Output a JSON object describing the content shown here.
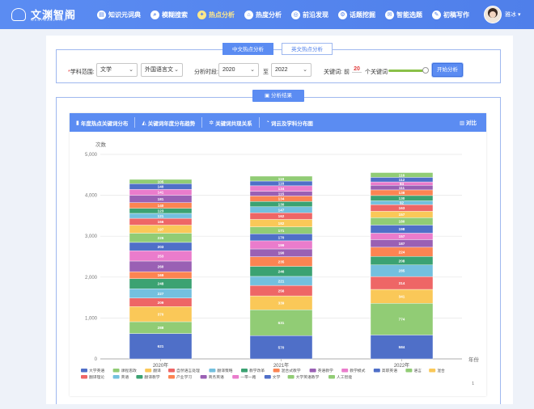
{
  "brand": {
    "name": "文渊智阁",
    "sub": "WENYUANZHIGE"
  },
  "nav": [
    {
      "label": "知识元词典",
      "icon": "book-icon"
    },
    {
      "label": "模糊搜索",
      "icon": "search-icon"
    },
    {
      "label": "热点分析",
      "icon": "bulb-icon",
      "active": true
    },
    {
      "label": "热度分析",
      "icon": "home-icon"
    },
    {
      "label": "前沿发现",
      "icon": "compass-icon"
    },
    {
      "label": "话题挖掘",
      "icon": "gear-icon"
    },
    {
      "label": "智能选题",
      "icon": "chat-icon"
    },
    {
      "label": "初稿写作",
      "icon": "pen-icon"
    }
  ],
  "user": {
    "name": "雅冰 ▾"
  },
  "lang_tabs": {
    "cn": "中文热点分析",
    "en": "英文热点分析"
  },
  "filters": {
    "subject_label": "学科范围:",
    "subject_req": "*",
    "subject_value": "文学",
    "subject_sub": "外国语言文",
    "period_label": "分析时段:",
    "year_from": "2020",
    "to_label": "至",
    "year_to": "2022",
    "kw_label": "关键词:",
    "kw_prefix": "前",
    "kw_count": "20",
    "kw_suffix": "个关键词",
    "start_btn": "开始分析"
  },
  "result_label": "分析结果",
  "chart_tabs": [
    {
      "label": "年度热点关键词分布",
      "icon": "bar-icon"
    },
    {
      "label": "关键词年度分布趋势",
      "icon": "area-icon"
    },
    {
      "label": "关键词共现关系",
      "icon": "network-icon"
    },
    {
      "label": "词云及学科分布图",
      "icon": "pie-icon"
    }
  ],
  "contrast_label": "对比",
  "page_indicator": "1",
  "chart_data": {
    "type": "bar",
    "stacked": true,
    "ylabel": "次数",
    "xlabel": "年份",
    "ylim": [
      0,
      5000
    ],
    "yticks": [
      0,
      1000,
      2000,
      3000,
      4000,
      5000
    ],
    "categories": [
      "2020年",
      "2021年",
      "2022年"
    ],
    "series": [
      {
        "name": "大学英语",
        "color": "#4f6fc8",
        "values": [
          621,
          570,
          584
        ]
      },
      {
        "name": "课程思政",
        "color": "#91cc75",
        "values": [
          288,
          631,
          774
        ]
      },
      {
        "name": "翻译",
        "color": "#fac858",
        "values": [
          370,
          339,
          341
        ]
      },
      {
        "name": "自然语言处理",
        "color": "#ee6666",
        "values": [
          209,
          256,
          314
        ]
      },
      {
        "name": "翻译策略",
        "color": "#73c0de",
        "values": [
          227,
          221,
          285
        ]
      },
      {
        "name": "教学改革",
        "color": "#3ba272",
        "values": [
          248,
          246,
          208
        ]
      },
      {
        "name": "混合式教学",
        "color": "#fc8452",
        "values": [
          169,
          235,
          224
        ]
      },
      {
        "name": "英语教学",
        "color": "#9a60b4",
        "values": [
          260,
          190,
          187
        ]
      },
      {
        "name": "教学模式",
        "color": "#ea7ccc",
        "values": [
          253,
          199,
          157
        ]
      },
      {
        "name": "高职英语",
        "color": "#4f6fc8",
        "values": [
          203,
          170,
          198
        ]
      },
      {
        "name": "语言",
        "color": "#91cc75",
        "values": [
          226,
          171,
          180
        ]
      },
      {
        "name": "混合",
        "color": "#fac858",
        "values": [
          197,
          182,
          157
        ]
      },
      {
        "name": "翻译理论",
        "color": "#ee6666",
        "values": [
          166,
          162,
          163
        ]
      },
      {
        "name": "英语",
        "color": "#73c0de",
        "values": [
          121,
          147,
          92
        ]
      },
      {
        "name": "翻译教学",
        "color": "#3ba272",
        "values": [
          123,
          130,
          130
        ]
      },
      {
        "name": "产业学习",
        "color": "#fc8452",
        "values": [
          140,
          134,
          138
        ]
      },
      {
        "name": "商务英语",
        "color": "#9a60b4",
        "values": [
          181,
          115,
          111
        ]
      },
      {
        "name": "一带一路",
        "color": "#ea7ccc",
        "values": [
          141,
          134,
          84
        ]
      },
      {
        "name": "文学",
        "color": "#4f6fc8",
        "values": [
          140,
          116,
          112
        ]
      },
      {
        "name": "大学英语教学",
        "color": "#91cc75",
        "values": [
          105,
          119,
          116
        ]
      }
    ]
  },
  "legend": [
    {
      "name": "大学英语",
      "color": "#4f6fc8"
    },
    {
      "name": "课程思政",
      "color": "#91cc75"
    },
    {
      "name": "翻译",
      "color": "#fac858"
    },
    {
      "name": "自然语言处理",
      "color": "#ee6666"
    },
    {
      "name": "翻译策略",
      "color": "#73c0de"
    },
    {
      "name": "教学改革",
      "color": "#3ba272"
    },
    {
      "name": "混合式教学",
      "color": "#fc8452"
    },
    {
      "name": "英语教学",
      "color": "#9a60b4"
    },
    {
      "name": "教学模式",
      "color": "#ea7ccc"
    },
    {
      "name": "高职英语",
      "color": "#4f6fc8"
    },
    {
      "name": "语言",
      "color": "#91cc75"
    },
    {
      "name": "混合",
      "color": "#fac858"
    },
    {
      "name": "翻译理论",
      "color": "#ee6666"
    },
    {
      "name": "英语",
      "color": "#73c0de"
    },
    {
      "name": "翻译教学",
      "color": "#3ba272"
    },
    {
      "name": "产业学习",
      "color": "#fc8452"
    },
    {
      "name": "商务英语",
      "color": "#9a60b4"
    },
    {
      "name": "一带一路",
      "color": "#ea7ccc"
    },
    {
      "name": "文学",
      "color": "#4f6fc8"
    },
    {
      "name": "大学英语教学",
      "color": "#91cc75"
    },
    {
      "name": "人工智能",
      "color": "#91cc75"
    }
  ]
}
